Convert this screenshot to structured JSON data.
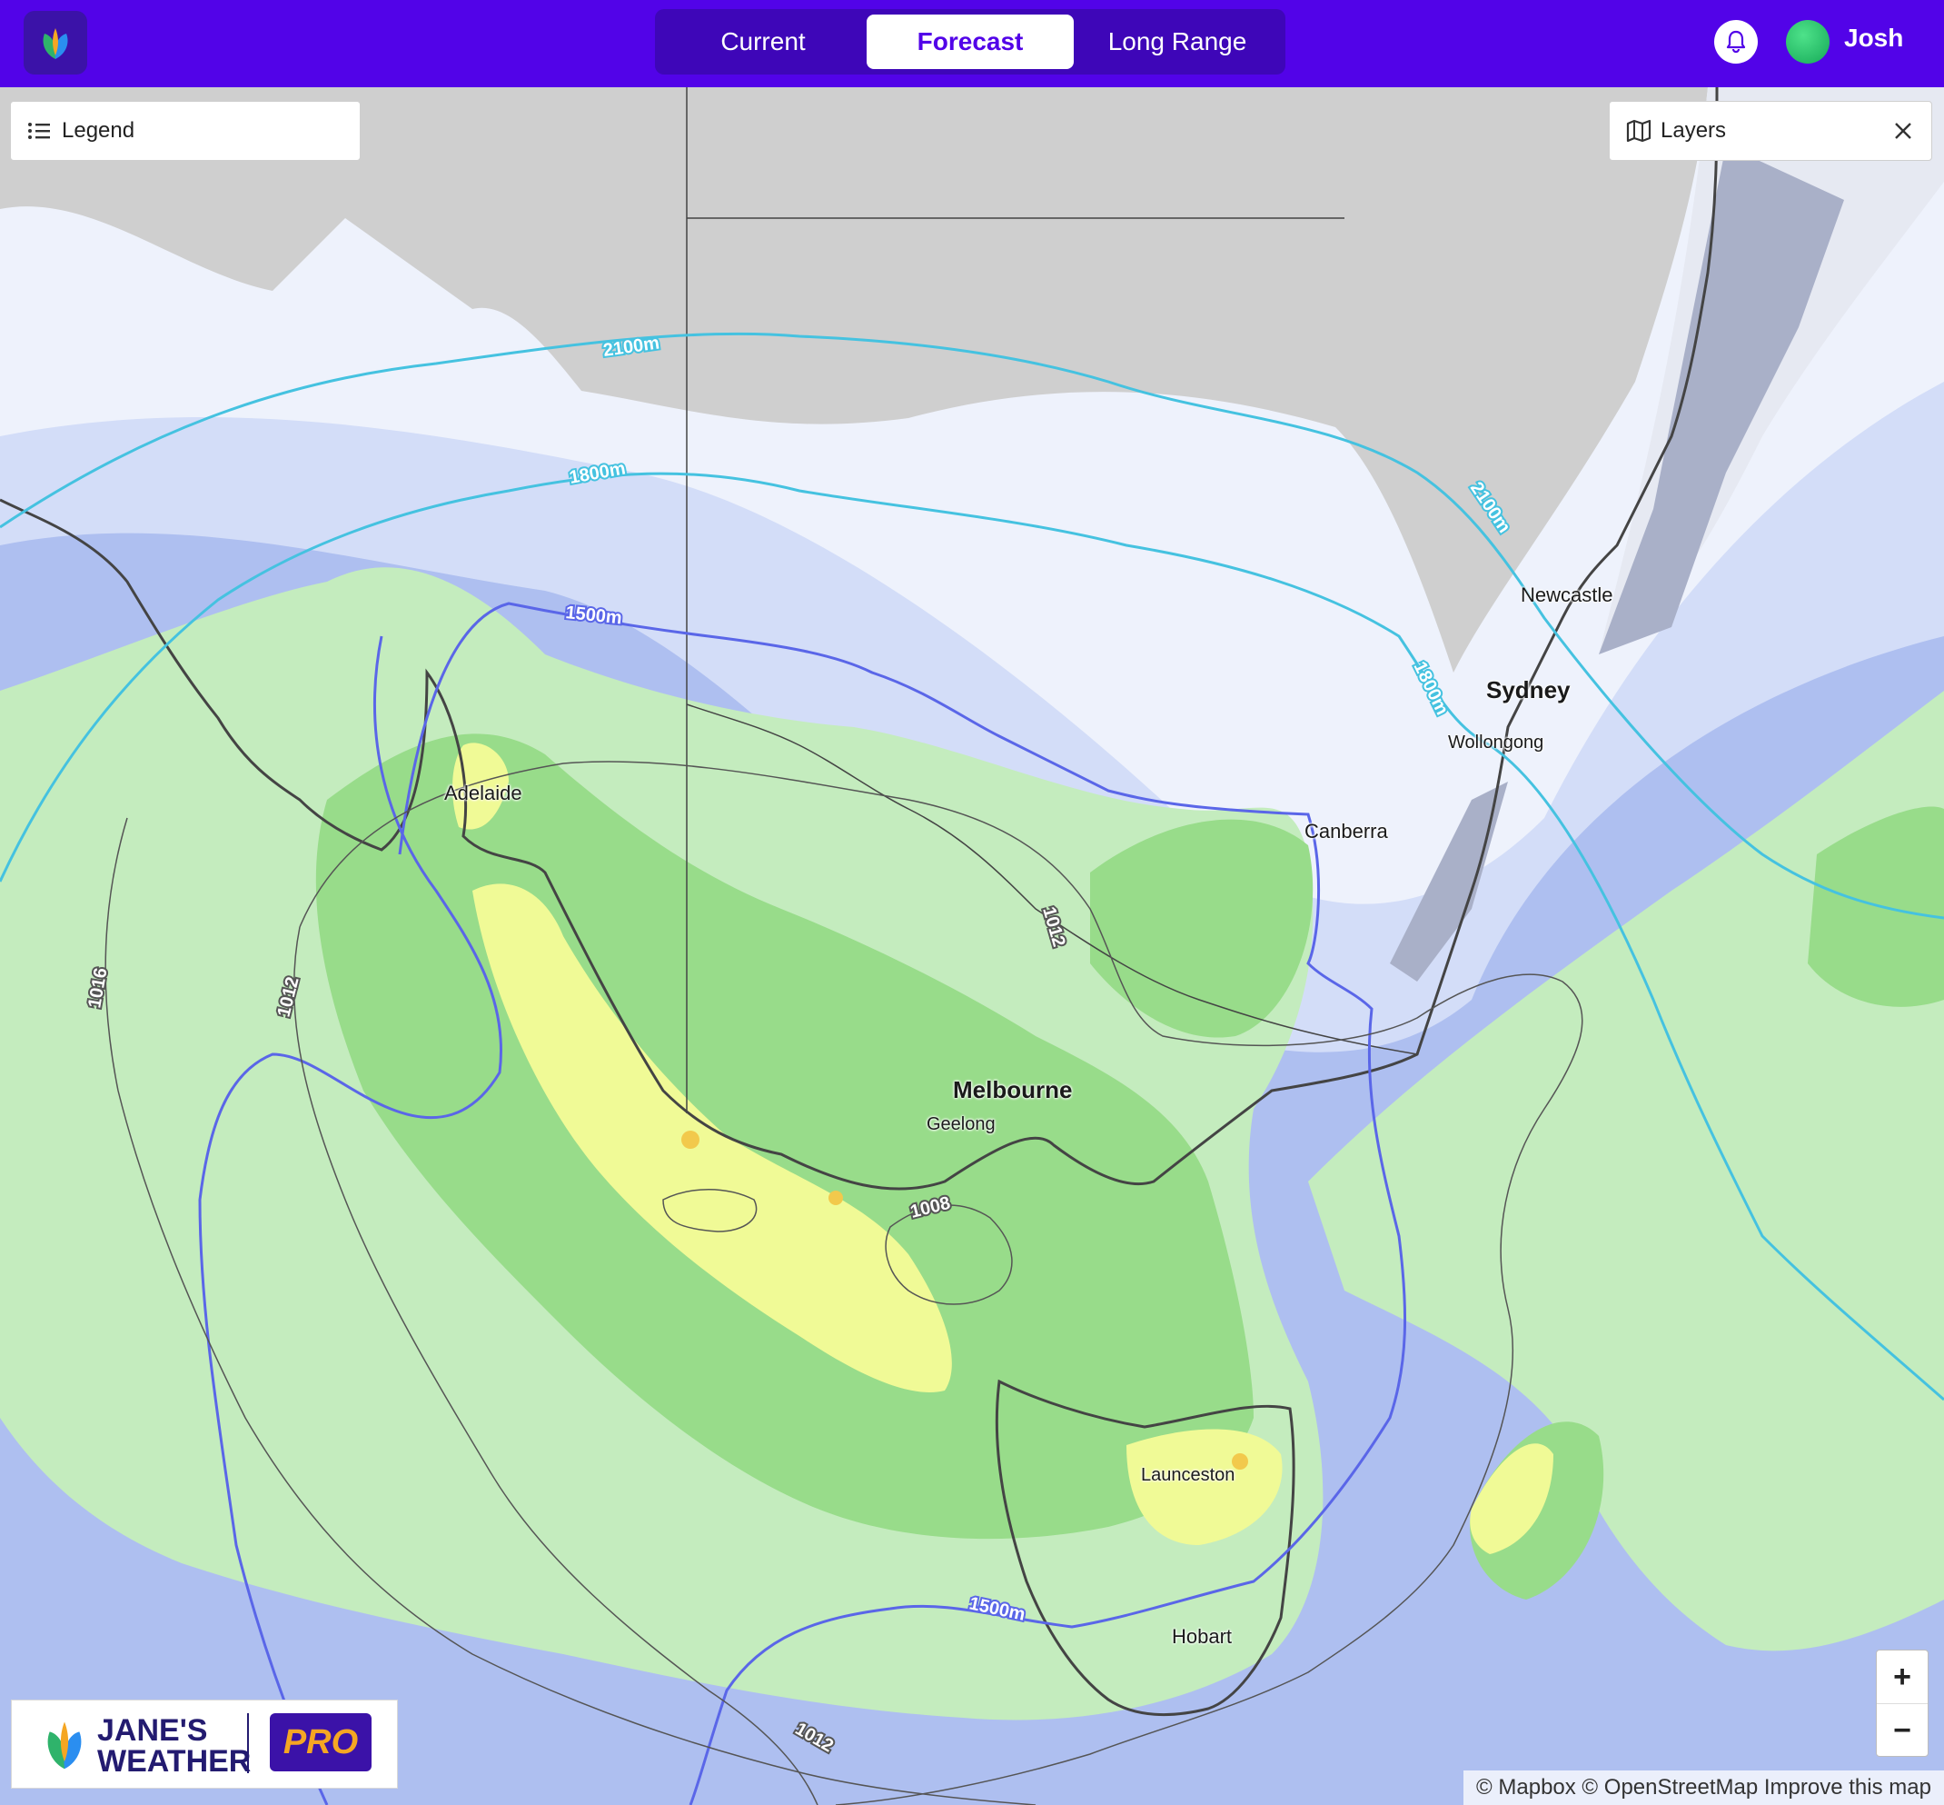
{
  "header": {
    "tabs": [
      {
        "label": "Current",
        "active": false
      },
      {
        "label": "Forecast",
        "active": true
      },
      {
        "label": "Long Range",
        "active": false
      }
    ],
    "user": {
      "name": "Josh"
    },
    "icons": {
      "app_logo": "leaf-logo-icon",
      "notifications": "bell-icon",
      "avatar": "green-avatar"
    }
  },
  "panels": {
    "legend": {
      "label": "Legend",
      "icon": "list-icon"
    },
    "layers": {
      "label": "Layers",
      "icon": "map-icon",
      "close_icon": "close-icon"
    }
  },
  "map": {
    "cities": [
      "Newcastle",
      "Sydney",
      "Wollongong",
      "Canberra",
      "Adelaide",
      "Melbourne",
      "Geelong",
      "Launceston",
      "Hobart"
    ],
    "contour_labels": [
      "2100m",
      "1800m",
      "1500m",
      "2100m",
      "1800m",
      "1500m",
      "1012",
      "1016",
      "1012",
      "1008",
      "1012"
    ],
    "colors": {
      "ocean": "#aebff0",
      "land": "#cfcfcf",
      "light_precip": "#c4ecbe",
      "moderate_precip": "#98dc8a",
      "heavy_precip": "#f0fa96",
      "very_heavy_precip": "#f2c94c",
      "height_contour": "#45c2e0",
      "height_1500": "#5a66e8"
    }
  },
  "controls": {
    "zoom_in": "+",
    "zoom_out": "−"
  },
  "brand": {
    "name": "JANE'S WEATHER",
    "badge": "PRO"
  },
  "attribution": "© Mapbox © OpenStreetMap Improve this map"
}
